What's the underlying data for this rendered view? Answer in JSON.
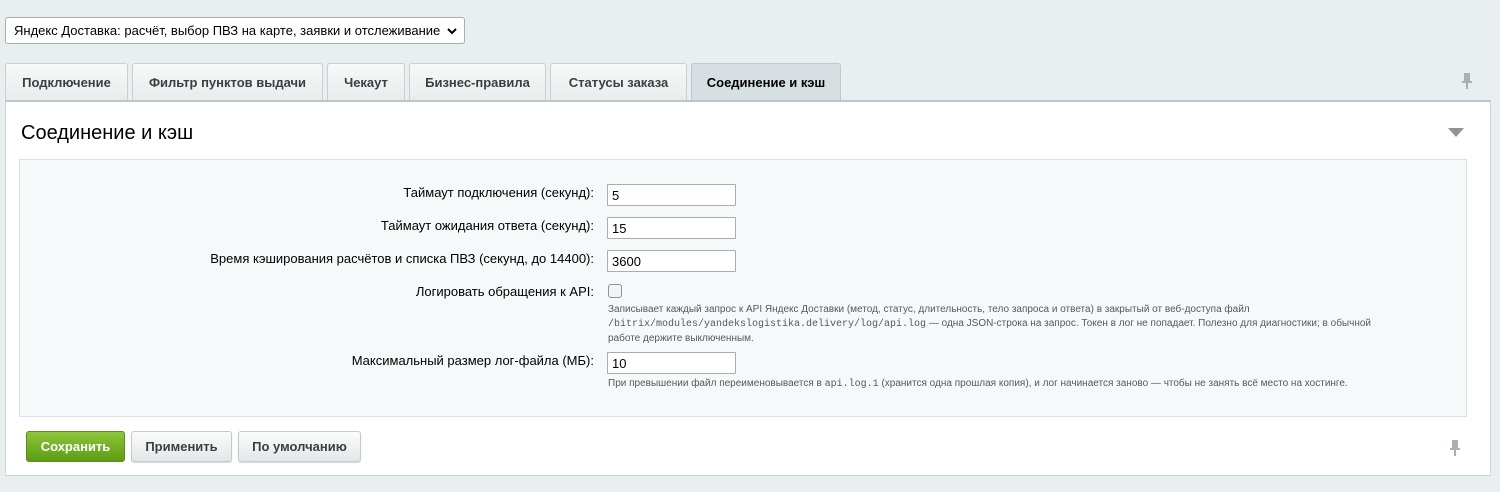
{
  "module_select": {
    "value": "Яндекс Доставка: расчёт, выбор ПВЗ на карте, заявки и отслеживание"
  },
  "tabs": [
    {
      "label": "Подключение"
    },
    {
      "label": "Фильтр пунктов выдачи"
    },
    {
      "label": "Чекаут"
    },
    {
      "label": "Бизнес-правила"
    },
    {
      "label": "Статусы заказа"
    },
    {
      "label": "Соединение и кэш"
    }
  ],
  "active_tab": "Соединение и кэш",
  "panel": {
    "title": "Соединение и кэш"
  },
  "form": {
    "connect_timeout": {
      "label": "Таймаут подключения (секунд):",
      "value": "5"
    },
    "response_timeout": {
      "label": "Таймаут ожидания ответа (секунд):",
      "value": "15"
    },
    "cache_time": {
      "label": "Время кэширования расчётов и списка ПВЗ (секунд, до 14400):",
      "value": "3600"
    },
    "log_api": {
      "label": "Логировать обращения к API:",
      "checked": false,
      "hint_line1": "Записывает каждый запрос к API Яндекс Доставки (метод, статус, длительность, тело запроса и ответа) в закрытый от веб-доступа файл",
      "hint_path": "/bitrix/modules/yandekslogistika.delivery/log/api.log",
      "hint_line2_rest": " — одна JSON-строка на запрос. Токен в лог не попадает. Полезно для диагностики; в обычной",
      "hint_line3": "работе держите выключенным."
    },
    "max_log_size": {
      "label": "Максимальный размер лог-файла (МБ):",
      "value": "10",
      "hint_pre": "При превышении файл переименовывается в ",
      "hint_file": "api.log.1",
      "hint_post": " (хранится одна прошлая копия), и лог начинается заново — чтобы не занять всё место на хостинге."
    }
  },
  "buttons": {
    "save": "Сохранить",
    "apply": "Применить",
    "defaults": "По умолчанию"
  },
  "colors": {
    "save_button": "#6aab1f",
    "background": "#e9eef0",
    "form_area": "#f5f9f9"
  }
}
